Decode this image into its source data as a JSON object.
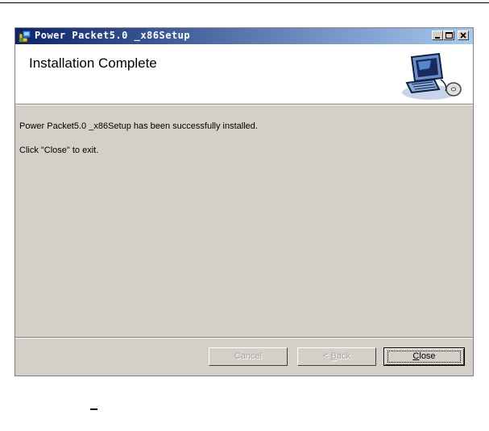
{
  "window": {
    "title": "Power Packet5.0 _x86Setup",
    "colors": {
      "titlebar_start": "#0a246a",
      "titlebar_end": "#a6caf0",
      "face": "#d4d0c8"
    }
  },
  "header": {
    "title": "Installation Complete",
    "graphic_icon": "computer-setup-icon"
  },
  "body": {
    "message_1": "Power Packet5.0 _x86Setup has been successfully installed.",
    "message_2": "Click \"Close\" to exit."
  },
  "buttons": {
    "cancel": "Cancel",
    "back_prefix": "< ",
    "back_mnemonic": "B",
    "back_rest": "ack",
    "close_mnemonic": "C",
    "close_rest": "lose"
  }
}
